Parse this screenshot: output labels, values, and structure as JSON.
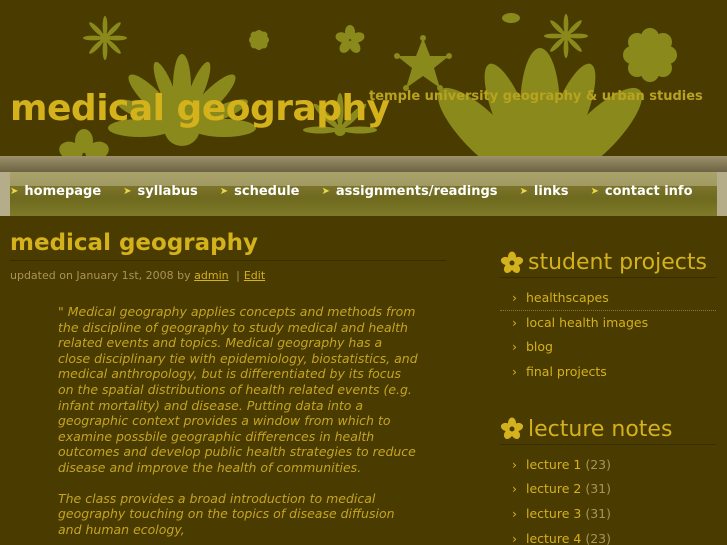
{
  "site": {
    "title": "medical geography",
    "tagline": "temple university geography & urban studies"
  },
  "nav": {
    "items": [
      "homepage",
      "syllabus",
      "schedule",
      "assignments/readings",
      "links",
      "contact info"
    ]
  },
  "post": {
    "title": "medical geography",
    "meta_prefix": "updated on January 1st, 2008 by",
    "author": "admin",
    "separator": "|",
    "edit": "Edit",
    "quote_p1": "\" Medical geography applies concepts and methods from the discipline of geography to study medical and health related events and topics. Medical geography has a close disciplinary tie with epidemiology, biostatistics, and medical anthropology, but is differentiated by its focus on the spatial distributions of health related events (e.g. infant mortality) and disease. Putting data into a geographic context provides a window from which to examine possbile geographic differences in health outcomes and develop public health strategies to reduce disease and improve the health of communities.",
    "quote_p2": "The class provides a broad introduction to medical geography touching on the topics of disease diffusion and human ecology,"
  },
  "sidebar": {
    "student_projects": {
      "title": "student projects",
      "items": [
        "healthscapes",
        "local health images",
        "blog",
        "final projects"
      ]
    },
    "lecture_notes": {
      "title": "lecture notes",
      "items": [
        {
          "label": "lecture 1",
          "count": "(23)"
        },
        {
          "label": "lecture 2",
          "count": "(31)"
        },
        {
          "label": "lecture 3",
          "count": "(31)"
        },
        {
          "label": "lecture 4",
          "count": "(23)"
        }
      ]
    }
  },
  "colors": {
    "background": "#4a3b00",
    "accent": "#d4b21c",
    "flower": "#8a8a1c"
  }
}
